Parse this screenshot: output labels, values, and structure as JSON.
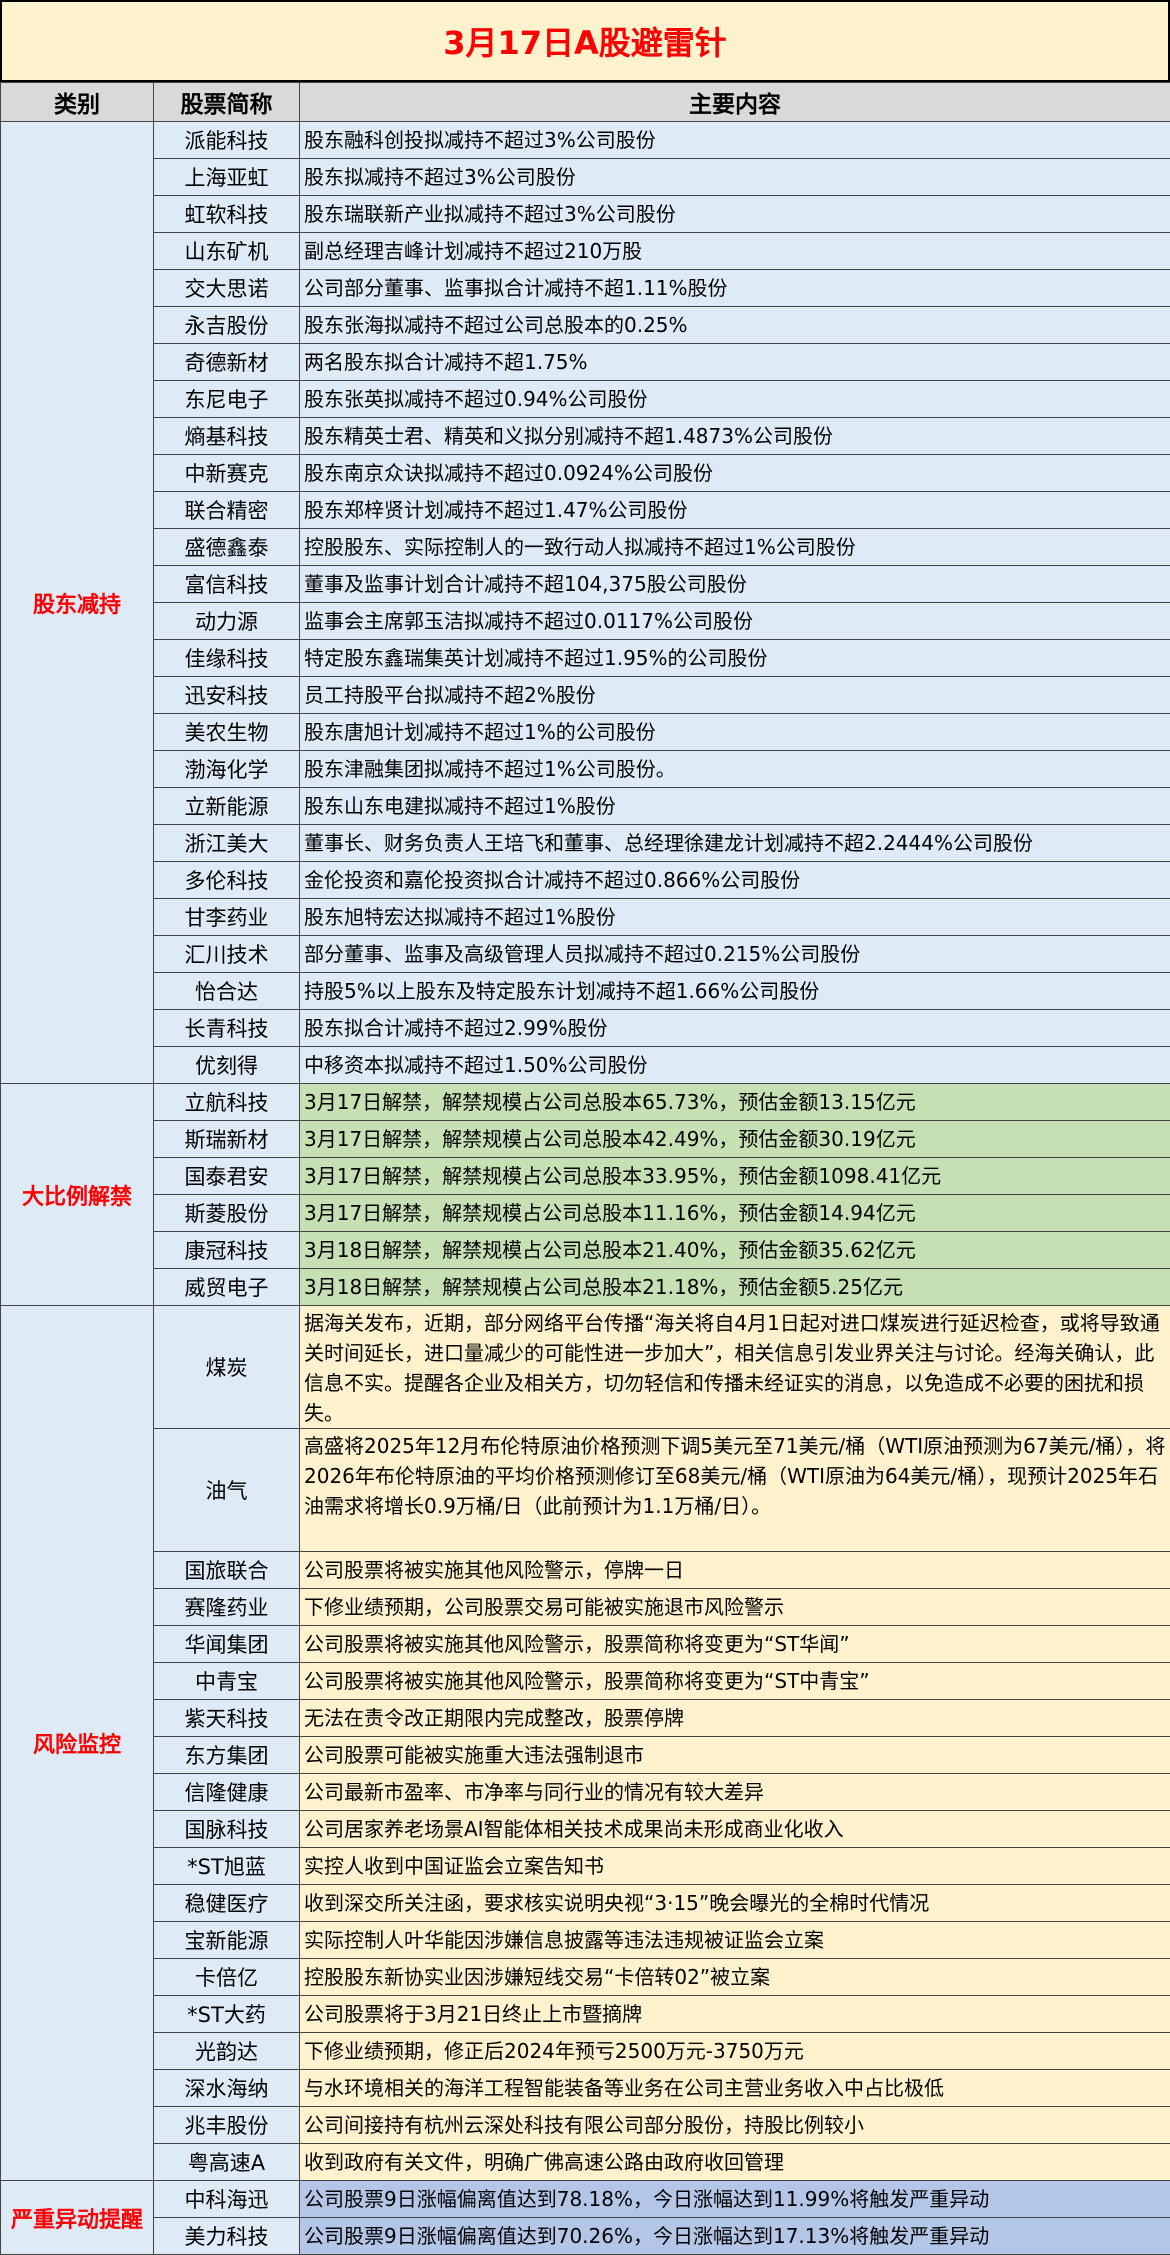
{
  "title": "3月17日A股避雷针",
  "header": {
    "category": "类别",
    "stock": "股票简称",
    "content": "主要内容"
  },
  "groups": [
    {
      "category": "股东减持",
      "rows": [
        {
          "name": "派能科技",
          "content": "股东融科创投拟减持不超过3%公司股份"
        },
        {
          "name": "上海亚虹",
          "content": "股东拟减持不超过3%公司股份"
        },
        {
          "name": "虹软科技",
          "content": "股东瑞联新产业拟减持不超过3%公司股份"
        },
        {
          "name": "山东矿机",
          "content": "副总经理吉峰计划减持不超过210万股"
        },
        {
          "name": "交大思诺",
          "content": "公司部分董事、监事拟合计减持不超1.11%股份"
        },
        {
          "name": "永吉股份",
          "content": "股东张海拟减持不超过公司总股本的0.25%"
        },
        {
          "name": "奇德新材",
          "content": "两名股东拟合计减持不超1.75%"
        },
        {
          "name": "东尼电子",
          "content": "股东张英拟减持不超过0.94%公司股份"
        },
        {
          "name": "熵基科技",
          "content": "股东精英士君、精英和义拟分别减持不超1.4873%公司股份"
        },
        {
          "name": "中新赛克",
          "content": "股东南京众诀拟减持不超过0.0924%公司股份"
        },
        {
          "name": "联合精密",
          "content": "股东郑梓贤计划减持不超过1.47%公司股份"
        },
        {
          "name": "盛德鑫泰",
          "content": "控股股东、实际控制人的一致行动人拟减持不超过1%公司股份"
        },
        {
          "name": "富信科技",
          "content": "董事及监事计划合计减持不超104,375股公司股份"
        },
        {
          "name": "动力源",
          "content": "监事会主席郭玉洁拟减持不超过0.0117%公司股份"
        },
        {
          "name": "佳缘科技",
          "content": "特定股东鑫瑞集英计划减持不超过1.95%的公司股份"
        },
        {
          "name": "迅安科技",
          "content": "员工持股平台拟减持不超2%股份"
        },
        {
          "name": "美农生物",
          "content": "股东唐旭计划减持不超过1%的公司股份"
        },
        {
          "name": "渤海化学",
          "content": "股东津融集团拟减持不超过1%公司股份。"
        },
        {
          "name": "立新能源",
          "content": "股东山东电建拟减持不超过1%股份"
        },
        {
          "name": "浙江美大",
          "content": "董事长、财务负责人王培飞和董事、总经理徐建龙计划减持不超2.2444%公司股份"
        },
        {
          "name": "多伦科技",
          "content": "金伦投资和嘉伦投资拟合计减持不超过0.866%公司股份"
        },
        {
          "name": "甘李药业",
          "content": "股东旭特宏达拟减持不超过1%股份"
        },
        {
          "name": "汇川技术",
          "content": "部分董事、监事及高级管理人员拟减持不超过0.215%公司股份"
        },
        {
          "name": "怡合达",
          "content": "持股5%以上股东及特定股东计划减持不超1.66%公司股份"
        },
        {
          "name": "长青科技",
          "content": "股东拟合计减持不超过2.99%股份"
        },
        {
          "name": "优刻得",
          "content": "中移资本拟减持不超过1.50%公司股份"
        }
      ]
    },
    {
      "category": "大比例解禁",
      "rows": [
        {
          "name": "立航科技",
          "content": "3月17日解禁，解禁规模占公司总股本65.73%，预估金额13.15亿元"
        },
        {
          "name": "斯瑞新材",
          "content": "3月17日解禁，解禁规模占公司总股本42.49%，预估金额30.19亿元"
        },
        {
          "name": "国泰君安",
          "content": "3月17日解禁，解禁规模占公司总股本33.95%，预估金额1098.41亿元"
        },
        {
          "name": "斯菱股份",
          "content": "3月17日解禁，解禁规模占公司总股本11.16%，预估金额14.94亿元"
        },
        {
          "name": "康冠科技",
          "content": "3月18日解禁，解禁规模占公司总股本21.40%，预估金额35.62亿元"
        },
        {
          "name": "威贸电子",
          "content": "3月18日解禁，解禁规模占公司总股本21.18%，预估金额5.25亿元"
        }
      ]
    },
    {
      "category": "风险监控",
      "rows": [
        {
          "name": "煤炭",
          "content": "据海关发布，近期，部分网络平台传播“海关将自4月1日起对进口煤炭进行延迟检查，或将导致通关时间延长，进口量减少的可能性进一步加大”，相关信息引发业界关注与讨论。经海关确认，此信息不实。提醒各企业及相关方，切勿轻信和传播未经证实的消息，以免造成不必要的困扰和损失。"
        },
        {
          "name": "油气",
          "content": "高盛将2025年12月布伦特原油价格预测下调5美元至71美元/桶（WTI原油预测为67美元/桶），将2026年布伦特原油的平均价格预测修订至68美元/桶（WTI原油为64美元/桶），现预计2025年石油需求将增长0.9万桶/日（此前预计为1.1万桶/日）。"
        },
        {
          "name": "国旅联合",
          "content": "公司股票将被实施其他风险警示，停牌一日"
        },
        {
          "name": "赛隆药业",
          "content": "下修业绩预期，公司股票交易可能被实施退市风险警示"
        },
        {
          "name": "华闻集团",
          "content": "公司股票将被实施其他风险警示，股票简称将变更为“ST华闻”"
        },
        {
          "name": "中青宝",
          "content": "公司股票将被实施其他风险警示，股票简称将变更为“ST中青宝”"
        },
        {
          "name": "紫天科技",
          "content": "无法在责令改正期限内完成整改，股票停牌"
        },
        {
          "name": "东方集团",
          "content": "公司股票可能被实施重大违法强制退市"
        },
        {
          "name": "信隆健康",
          "content": "公司最新市盈率、市净率与同行业的情况有较大差异"
        },
        {
          "name": "国脉科技",
          "content": "公司居家养老场景AI智能体相关技术成果尚未形成商业化收入"
        },
        {
          "name": "*ST旭蓝",
          "content": "实控人收到中国证监会立案告知书"
        },
        {
          "name": "稳健医疗",
          "content": "收到深交所关注函，要求核实说明央视“3·15”晚会曝光的全棉时代情况"
        },
        {
          "name": "宝新能源",
          "content": "实际控制人叶华能因涉嫌信息披露等违法违规被证监会立案"
        },
        {
          "name": "卡倍亿",
          "content": "控股股东新协实业因涉嫌短线交易“卡倍转02”被立案"
        },
        {
          "name": "*ST大药",
          "content": "公司股票将于3月21日终止上市暨摘牌"
        },
        {
          "name": "光韵达",
          "content": "下修业绩预期，修正后2024年预亏2500万元-3750万元"
        },
        {
          "name": "深水海纳",
          "content": "与水环境相关的海洋工程智能装备等业务在公司主营业务收入中占比极低"
        },
        {
          "name": "兆丰股份",
          "content": "公司间接持有杭州云深处科技有限公司部分股份，持股比例较小"
        },
        {
          "name": "粤高速A",
          "content": "收到政府有关文件，明确广佛高速公路由政府收回管理"
        }
      ]
    },
    {
      "category": "严重异动提醒",
      "rows": [
        {
          "name": "中科海迅",
          "content": "公司股票9日涨幅偏离值达到78.18%，今日涨幅达到11.99%将触发严重异动"
        },
        {
          "name": "美力科技",
          "content": "公司股票9日涨幅偏离值达到70.26%，今日涨幅达到17.13%将触发严重异动"
        }
      ]
    }
  ]
}
